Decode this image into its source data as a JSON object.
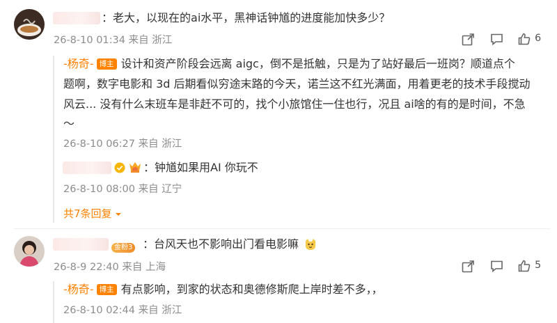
{
  "comments": [
    {
      "username_suffix": "：",
      "text": "老大，以现在的ai水平，黑神话钟馗的进度能加快多少？",
      "meta": "26-8-10 01:34 来自 浙江",
      "like_count": "6",
      "reply": {
        "author": "-杨奇-",
        "badge": "博主",
        "lines": [
          "设计和资产阶段会远离 aigc，倒不是抵触，只是为了站好最后一班岗？顺道点个",
          "题啊，数字电影和 3d 后期看似穷途末路的今天，诺兰这不红光满面，用着更老的技术手段搅动",
          "风云... 没有什么末班车是非赶不可的，找个小旅馆住一住也行，况且 ai啥的有的是时间，不急",
          "～"
        ],
        "meta": "26-8-10 06:27 来自 浙江"
      },
      "sub_reply": {
        "text": "钟馗如果用AI 你玩不",
        "meta": "26-8-10 08:00 来自 辽宁"
      },
      "more_replies": "共7条回复"
    },
    {
      "username_suffix": "：",
      "fan_badge": "金粉3",
      "text": "台风天也不影响出门看电影嘛",
      "meta": "26-8-9 22:40 来自 上海",
      "like_count": "5",
      "reply": {
        "author": "-杨奇-",
        "badge": "博主",
        "text": "有点影响，到家的状态和奥德修斯爬上岸时差不多，，",
        "meta": "26-8-10 02:44 来自 浙江"
      }
    }
  ],
  "colors": {
    "accent": "#ff8200",
    "meta": "#8c8c8c",
    "text": "#333333"
  },
  "icons": [
    "share-icon",
    "comment-icon",
    "like-icon",
    "verified-icon",
    "emoji-cat-icon",
    "dropdown-icon"
  ]
}
